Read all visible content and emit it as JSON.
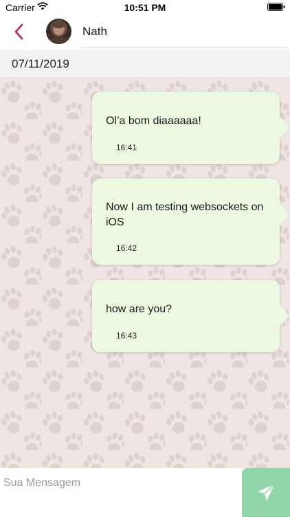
{
  "status_bar": {
    "carrier": "Carrier",
    "time": "10:51 PM"
  },
  "header": {
    "contact_name": "Nath",
    "back_icon": "chevron-left-icon",
    "accent_color": "#b0305f"
  },
  "date_separator": "07/11/2019",
  "messages": [
    {
      "text": "Ol’a bom diaaaaaa!",
      "time": "16:41"
    },
    {
      "text": "Now I am testing websockets on iOS",
      "time": "16:42"
    },
    {
      "text": "how are you?",
      "time": "16:43"
    }
  ],
  "composer": {
    "placeholder": "Sua Mensagem",
    "value": "",
    "send_icon": "send-icon",
    "send_color": "#8fd7a8"
  },
  "colors": {
    "bubble": "#ecf8e2",
    "chat_background": "#efe6e3"
  }
}
